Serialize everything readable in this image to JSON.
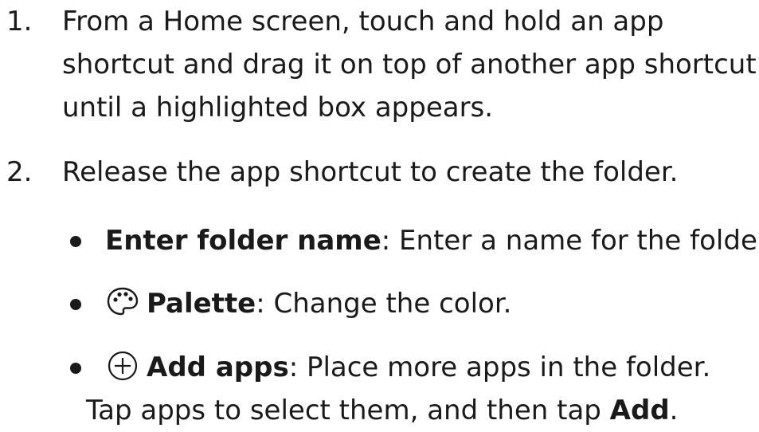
{
  "steps": [
    {
      "number": "1.",
      "lines": [
        "From a Home screen, touch and hold an app",
        "shortcut and drag it on top of another app shortcut",
        "until a highlighted box appears."
      ]
    },
    {
      "number": "2.",
      "lines": [
        "Release the app shortcut to create the folder."
      ]
    }
  ],
  "bullets": [
    {
      "term": "Enter folder name",
      "desc": ": Enter a name for the folder."
    },
    {
      "icon": "palette-icon",
      "term": "Palette",
      "desc": ": Change the color."
    },
    {
      "icon": "add-circle-icon",
      "term": "Add apps",
      "desc": ": Place more apps in the folder.",
      "line2_pre": "Tap apps to select them, and then tap ",
      "line2_term": "Add",
      "line2_post": "."
    }
  ]
}
